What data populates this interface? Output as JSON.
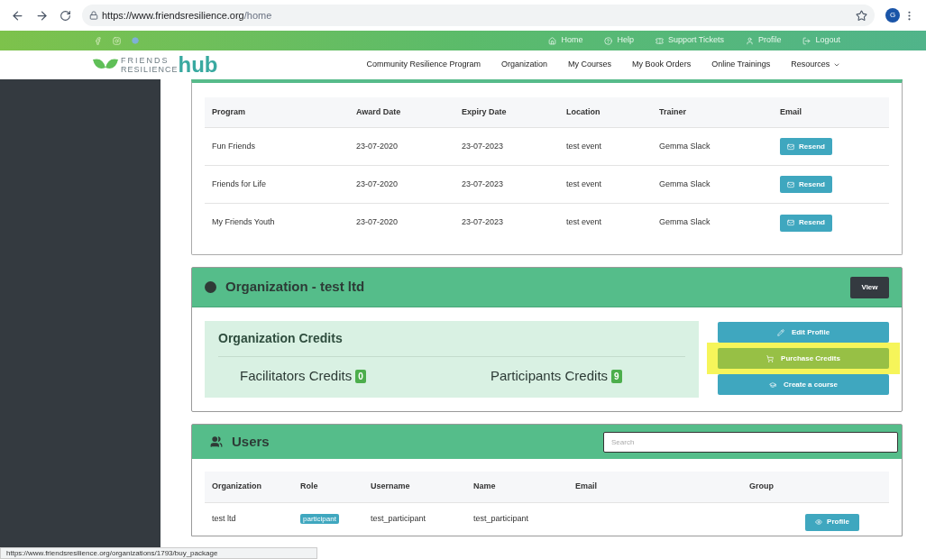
{
  "browser": {
    "url_host": "https://www.friendsresilience.org",
    "url_path": "/home",
    "avatar": "G"
  },
  "top_bar": {
    "links": [
      {
        "label": "Home"
      },
      {
        "label": "Help"
      },
      {
        "label": "Support Tickets"
      },
      {
        "label": "Profile"
      },
      {
        "label": "Logout"
      }
    ]
  },
  "logo": {
    "line1": "FRIENDS",
    "line2": "RESILIENCE",
    "word": "hub"
  },
  "nav": [
    {
      "label": "Community Resilience Program",
      "dropdown": false
    },
    {
      "label": "Organization",
      "dropdown": false
    },
    {
      "label": "My Courses",
      "dropdown": false
    },
    {
      "label": "My Book Orders",
      "dropdown": false
    },
    {
      "label": "Online Trainings",
      "dropdown": false
    },
    {
      "label": "Resources",
      "dropdown": true
    }
  ],
  "certificates": {
    "columns": [
      "Program",
      "Award Date",
      "Expiry Date",
      "Location",
      "Trainer",
      "Email"
    ],
    "rows": [
      {
        "cells": [
          "Fun Friends",
          "23-07-2020",
          "23-07-2023",
          "test event",
          "Gemma Slack"
        ],
        "button": "Resend"
      },
      {
        "cells": [
          "Friends for Life",
          "23-07-2020",
          "23-07-2023",
          "test event",
          "Gemma Slack"
        ],
        "button": "Resend"
      },
      {
        "cells": [
          "My Friends Youth",
          "23-07-2020",
          "23-07-2023",
          "test event",
          "Gemma Slack"
        ],
        "button": "Resend"
      }
    ]
  },
  "organization": {
    "title": "Organization - test ltd",
    "view_button": "View",
    "credits_title": "Organization Credits",
    "credits": [
      {
        "label": "Facilitators Credits",
        "count": "0"
      },
      {
        "label": "Participants Credits",
        "count": "9"
      }
    ],
    "actions": [
      {
        "kind": "edit",
        "label": "Edit Profile",
        "highlighted": false
      },
      {
        "kind": "cart",
        "label": "Purchase Credits",
        "highlighted": true
      },
      {
        "kind": "course",
        "label": "Create a course",
        "highlighted": false
      }
    ]
  },
  "users": {
    "title": "Users",
    "search": {
      "placeholder": "Search"
    },
    "columns": [
      "Organization",
      "Role",
      "Username",
      "Name",
      "Email",
      "Group"
    ],
    "rows": [
      {
        "organization": "test ltd",
        "role": "participant",
        "username": "test_participant",
        "name": "test_participant",
        "button": "Profile"
      }
    ]
  },
  "status_url": "https://www.friendsresilience.org/organizations/1793/buy_package"
}
